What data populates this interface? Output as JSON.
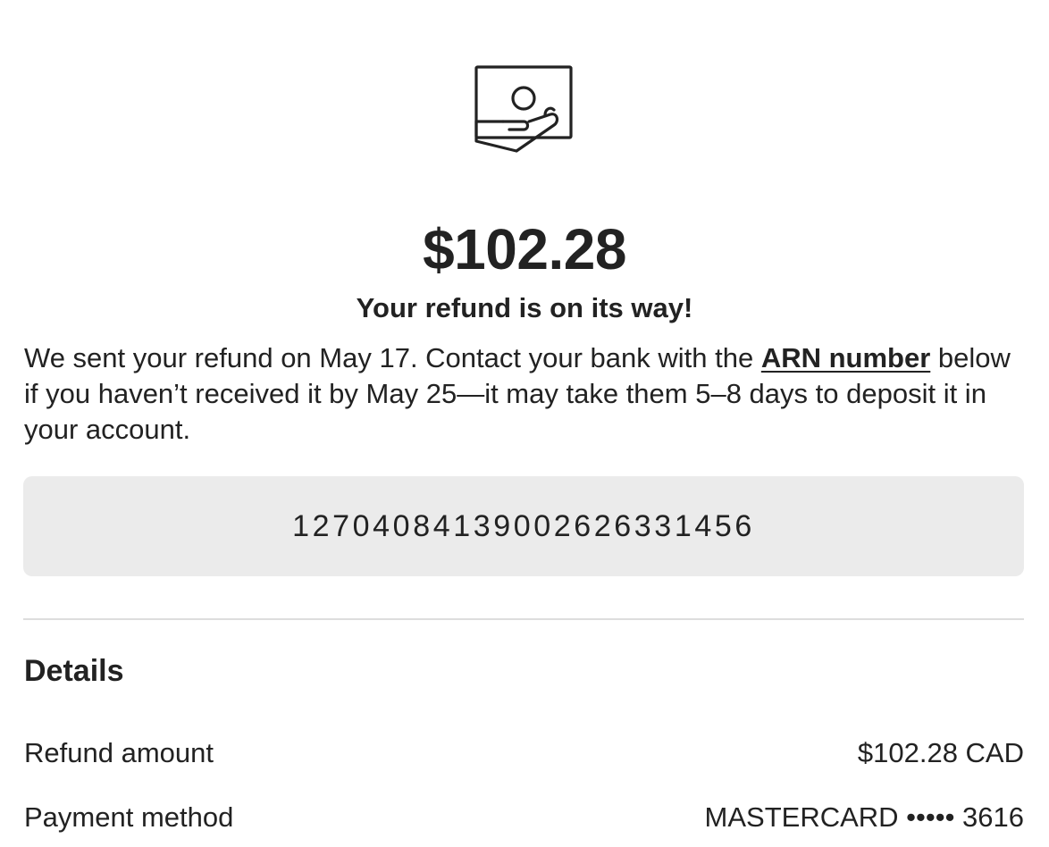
{
  "hero": {
    "icon": "hand-holding-card-icon",
    "amount": "$102.28",
    "subtitle": "Your refund is on its way!"
  },
  "message": {
    "part1": "We sent your refund on May 17. Contact your bank with the ",
    "link_label": "ARN number",
    "part2": " below if you haven’t received it by May 25—it may take them 5–8 days to deposit it in your account."
  },
  "arn": {
    "value": "12704084139002626331456"
  },
  "details": {
    "title": "Details",
    "rows": [
      {
        "label": "Refund amount",
        "value": "$102.28 CAD"
      },
      {
        "label": "Payment method",
        "value": "MASTERCARD ••••• 3616"
      }
    ]
  },
  "colors": {
    "text": "#222222",
    "arn_background": "#ebebeb",
    "divider": "#dddddd"
  }
}
